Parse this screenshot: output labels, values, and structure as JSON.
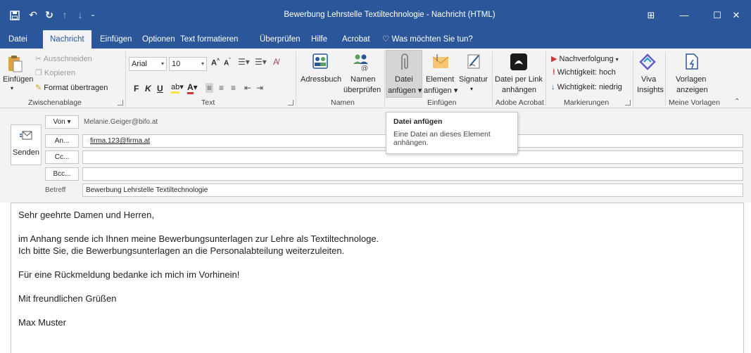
{
  "window": {
    "title": "Bewerbung Lehrstelle Textiltechnologie  -  Nachricht (HTML)",
    "controls": {
      "ribbon_display": "⊞",
      "minimize": "—",
      "maximize": "☐",
      "close": "✕"
    }
  },
  "tabs": [
    "Datei",
    "Nachricht",
    "Einfügen",
    "Optionen",
    "Text formatieren",
    "Überprüfen",
    "Hilfe",
    "Acrobat",
    "Was möchten Sie tun?"
  ],
  "active_tab": "Nachricht",
  "ribbon": {
    "clipboard": {
      "paste": "Einfügen",
      "cut": "Ausschneiden",
      "copy": "Kopieren",
      "format_painter": "Format übertragen",
      "label": "Zwischenablage"
    },
    "text": {
      "font": "Arial",
      "size": "10",
      "bold": "F",
      "italic": "K",
      "underline": "U",
      "label": "Text"
    },
    "names": {
      "address_book": "Adressbuch",
      "check_names_1": "Namen",
      "check_names_2": "überprüfen",
      "label": "Namen"
    },
    "insert": {
      "attach_file_1": "Datei",
      "attach_file_2": "anfügen",
      "attach_item_1": "Element",
      "attach_item_2": "anfügen",
      "signature": "Signatur",
      "label": "Einfügen"
    },
    "acrobat": {
      "attach_link_1": "Datei per Link",
      "attach_link_2": "anhängen",
      "label": "Adobe Acrobat"
    },
    "tags": {
      "follow_up": "Nachverfolgung",
      "high_importance": "Wichtigkeit: hoch",
      "low_importance": "Wichtigkeit: niedrig",
      "label": "Markierungen"
    },
    "viva": {
      "label_1": "Viva",
      "label_2": "Insights"
    },
    "templates": {
      "view_1": "Vorlagen",
      "view_2": "anzeigen",
      "label": "Meine Vorlagen"
    }
  },
  "tooltip": {
    "title": "Datei anfügen",
    "text_1": "Eine Datei an dieses Element",
    "text_2": "anhängen."
  },
  "compose": {
    "send": "Senden",
    "from_label": "Von",
    "from_value": "Melanie.Geiger@bifo.at",
    "to_label": "An...",
    "to_value": "firma.123@firma.at",
    "cc_label": "Cc...",
    "bcc_label": "Bcc...",
    "subject_label": "Betreff",
    "subject_value": "Bewerbung Lehrstelle Textiltechnologie"
  },
  "body": {
    "greeting": "Sehr geehrte Damen und Herren,",
    "line1": "im Anhang sende ich Ihnen meine Bewerbungsunterlagen zur Lehre als Textiltechnologe.",
    "line2": "Ich bitte Sie, die Bewerbungsunterlagen an die Personalabteilung weiterzuleiten.",
    "line3": "Für eine Rückmeldung bedanke ich mich im Vorhinein!",
    "closing": "Mit freundlichen Grüßen",
    "signature": "Max Muster"
  },
  "colors": {
    "accent": "#2b579a",
    "ribbon_bg": "#f3f3f3",
    "border": "#c6c6c6",
    "flag_red": "#d13438"
  }
}
